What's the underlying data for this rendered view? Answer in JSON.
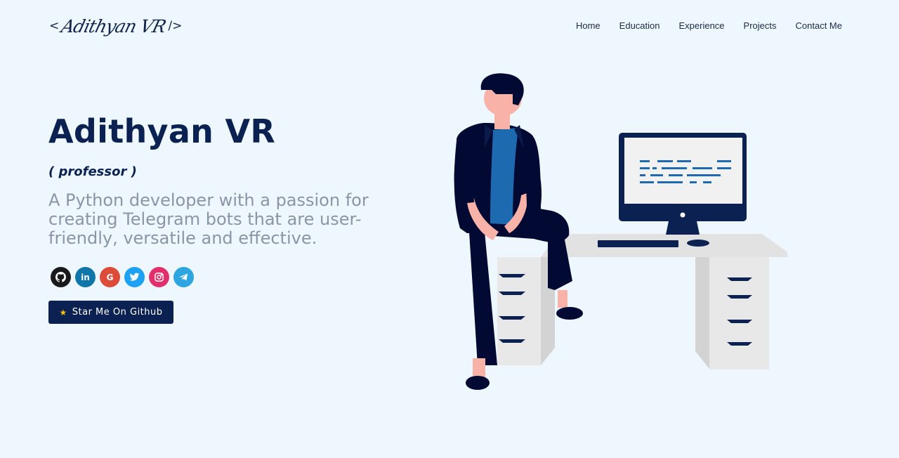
{
  "logo": {
    "open": "<",
    "signature": "Adithyan VR",
    "close": "/>"
  },
  "nav": {
    "items": [
      "Home",
      "Education",
      "Experience",
      "Projects",
      "Contact Me"
    ]
  },
  "hero": {
    "name": "Adithyan VR",
    "nickname": "( professor )",
    "description": "A Python developer with a passion for creating Telegram bots that are user-friendly, versatile and effective."
  },
  "socials": [
    {
      "name": "github-icon",
      "color": "#1a1a1a"
    },
    {
      "name": "linkedin-icon",
      "color": "#0e76a8",
      "glyph": "in"
    },
    {
      "name": "google-icon",
      "color": "#dd4b39",
      "glyph": "G"
    },
    {
      "name": "twitter-icon",
      "color": "#1da1f2"
    },
    {
      "name": "instagram-icon",
      "color": "#e1306c"
    },
    {
      "name": "telegram-icon",
      "color": "#2ca5e0"
    }
  ],
  "cta": {
    "label": "Star Me On Github",
    "icon": "star-icon"
  },
  "colors": {
    "background": "#edf7fd",
    "primary": "#0b2152",
    "muted_text": "#8a95a8"
  }
}
